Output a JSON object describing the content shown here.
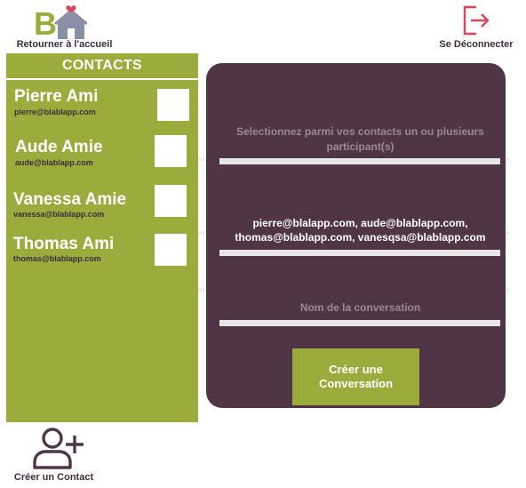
{
  "header": {
    "home_label": "Retourner à l'accueil",
    "logout_label": "Se Déconnecter"
  },
  "contacts": {
    "title": "CONTACTS",
    "items": [
      {
        "name": "Pierre Ami",
        "email": "pierre@blablapp.com"
      },
      {
        "name": "Aude Amie",
        "email": "aude@blablapp.com"
      },
      {
        "name": "Vanessa Amie",
        "email": "vanessa@blablapp.com"
      },
      {
        "name": "Thomas Ami",
        "email": "thomas@blablapp.com"
      }
    ]
  },
  "create_contact": {
    "label": "Créer un Contact"
  },
  "form": {
    "participants_hint": "Selectionnez parmi vos contacts un ou plusieurs participant(s)",
    "participants_value": "pierre@blalapp.com, aude@blablapp.com, thomas@blablapp.com, vanesqsa@blablapp.com",
    "conversation_name_placeholder": "Nom de la conversation",
    "create_button": "Créer une Conversation"
  },
  "colors": {
    "olive": "#9bab3c",
    "plum": "#4f3546",
    "accent_red": "#d9465b",
    "house_gray": "#8a8fa8"
  },
  "icons": {
    "logo": "logo-b-house-icon",
    "logout": "logout-icon",
    "add_contact": "add-user-icon"
  }
}
